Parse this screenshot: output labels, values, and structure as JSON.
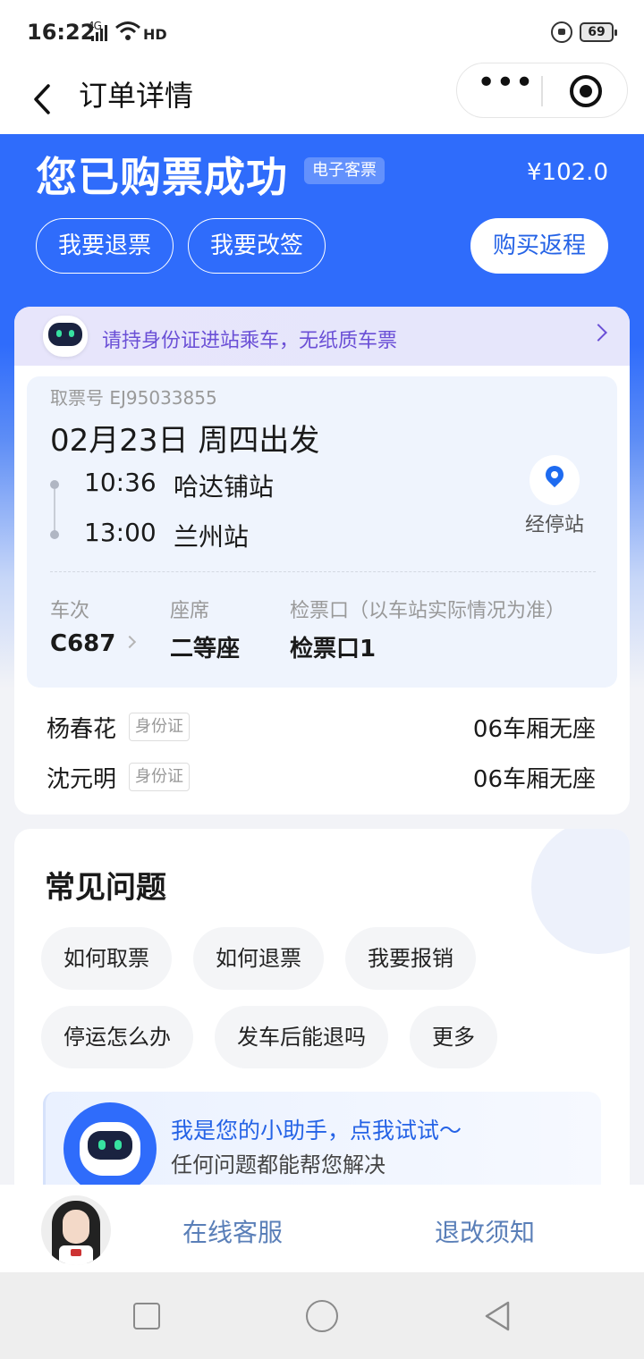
{
  "status_bar": {
    "time": "16:22",
    "network": "4G",
    "hd": "HD",
    "battery": "69"
  },
  "nav": {
    "title": "订单详情",
    "more_icon": "more-dots-icon",
    "close_icon": "target-close-icon"
  },
  "hero": {
    "title": "您已购票成功",
    "tag": "电子客票",
    "price": "¥102.0",
    "buttons": {
      "refund": "我要退票",
      "change": "我要改签",
      "return": "购买返程"
    }
  },
  "notice": {
    "text": "请持身份证进站乘车，无纸质车票"
  },
  "trip": {
    "ticket_no": "取票号 EJ95033855",
    "date": "02月23日 周四出发",
    "depart_time": "10:36",
    "depart_station": "哈达铺站",
    "arrive_time": "13:00",
    "arrive_station": "兰州站",
    "stops_label": "经停站",
    "train_label": "车次",
    "train_value": "C687",
    "seat_label": "座席",
    "seat_value": "二等座",
    "gate_label": "检票口（以车站实际情况为准）",
    "gate_value": "检票口1"
  },
  "passengers": [
    {
      "name": "杨春花",
      "id_type": "身份证",
      "seat": "06车厢无座"
    },
    {
      "name": "沈元明",
      "id_type": "身份证",
      "seat": "06车厢无座"
    }
  ],
  "faq": {
    "title": "常见问题",
    "chips": [
      "如何取票",
      "如何退票",
      "我要报销",
      "停运怎么办",
      "发车后能退吗",
      "更多"
    ],
    "assistant_line1": "我是您的小助手，点我试试～",
    "assistant_line2": "任何问题都能帮您解决"
  },
  "bottom_bar": {
    "service": "在线客服",
    "rules": "退改须知"
  },
  "colors": {
    "brand_blue": "#2f6cfb",
    "notice_purple": "#6a4fd6",
    "link_blue": "#2563e6"
  }
}
